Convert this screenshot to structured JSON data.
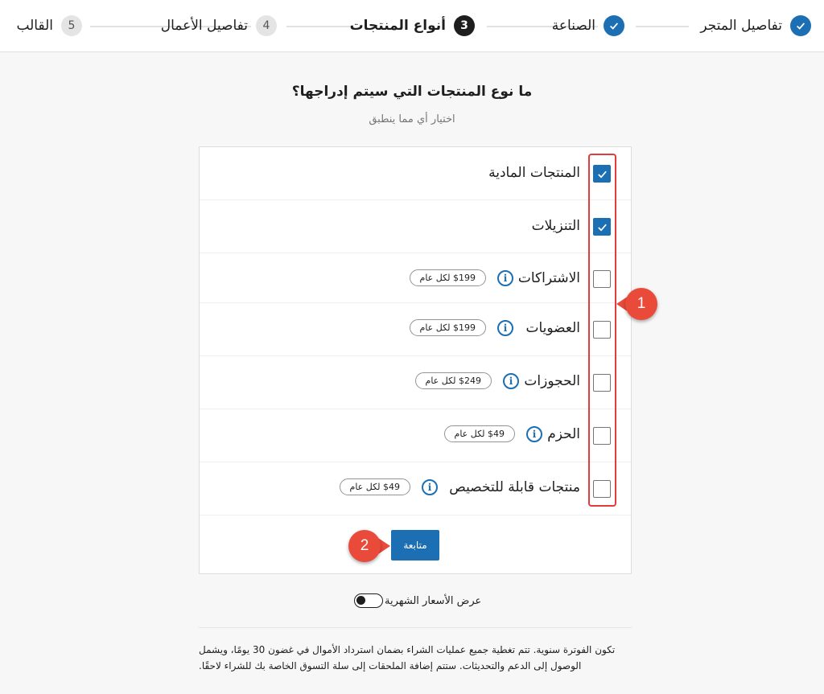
{
  "stepper": {
    "steps": [
      {
        "number": "",
        "label": "تفاصيل المتجر",
        "state": "done"
      },
      {
        "number": "",
        "label": "الصناعة",
        "state": "done"
      },
      {
        "number": "3",
        "label": "أنواع المنتجات",
        "state": "active"
      },
      {
        "number": "4",
        "label": "تفاصيل الأعمال",
        "state": "todo"
      },
      {
        "number": "5",
        "label": "القالب",
        "state": "todo"
      }
    ]
  },
  "page": {
    "title": "ما نوع المنتجات التي سيتم إدراجها؟",
    "subtitle": "اختيار أي مما ينطبق"
  },
  "options": [
    {
      "label": "المنتجات المادية",
      "checked": true,
      "price": ""
    },
    {
      "label": "التنزيلات",
      "checked": true,
      "price": ""
    },
    {
      "label": "الاشتراكات",
      "checked": false,
      "price": "$199 لكل عام"
    },
    {
      "label": "العضويات",
      "checked": false,
      "price": "$199 لكل عام"
    },
    {
      "label": "الحجوزات",
      "checked": false,
      "price": "$249 لكل عام"
    },
    {
      "label": "الحزم",
      "checked": false,
      "price": "$49 لكل عام"
    },
    {
      "label": "منتجات قابلة للتخصيص",
      "checked": false,
      "price": "$49 لكل عام"
    }
  ],
  "actions": {
    "continue_label": "متابعة"
  },
  "toggle": {
    "label": "عرض الأسعار الشهرية",
    "on": false
  },
  "footnote": "تكون الفوترة سنوية. تتم تغطية جميع عمليات الشراء بضمان استرداد الأموال في غضون 30 يومًا، ويشمل الوصول إلى الدعم والتحديثات. ستتم إضافة الملحقات إلى سلة التسوق الخاصة بك للشراء لاحقًا.",
  "annotations": {
    "badge_1": "1",
    "badge_2": "2"
  },
  "colors": {
    "accent": "#1c6fb3",
    "annotation": "#ea4a3a",
    "highlight": "#e23b3b"
  },
  "icons": {
    "done_step": "checkmark-icon",
    "checked_box": "checkmark-icon",
    "info": "info-icon"
  }
}
